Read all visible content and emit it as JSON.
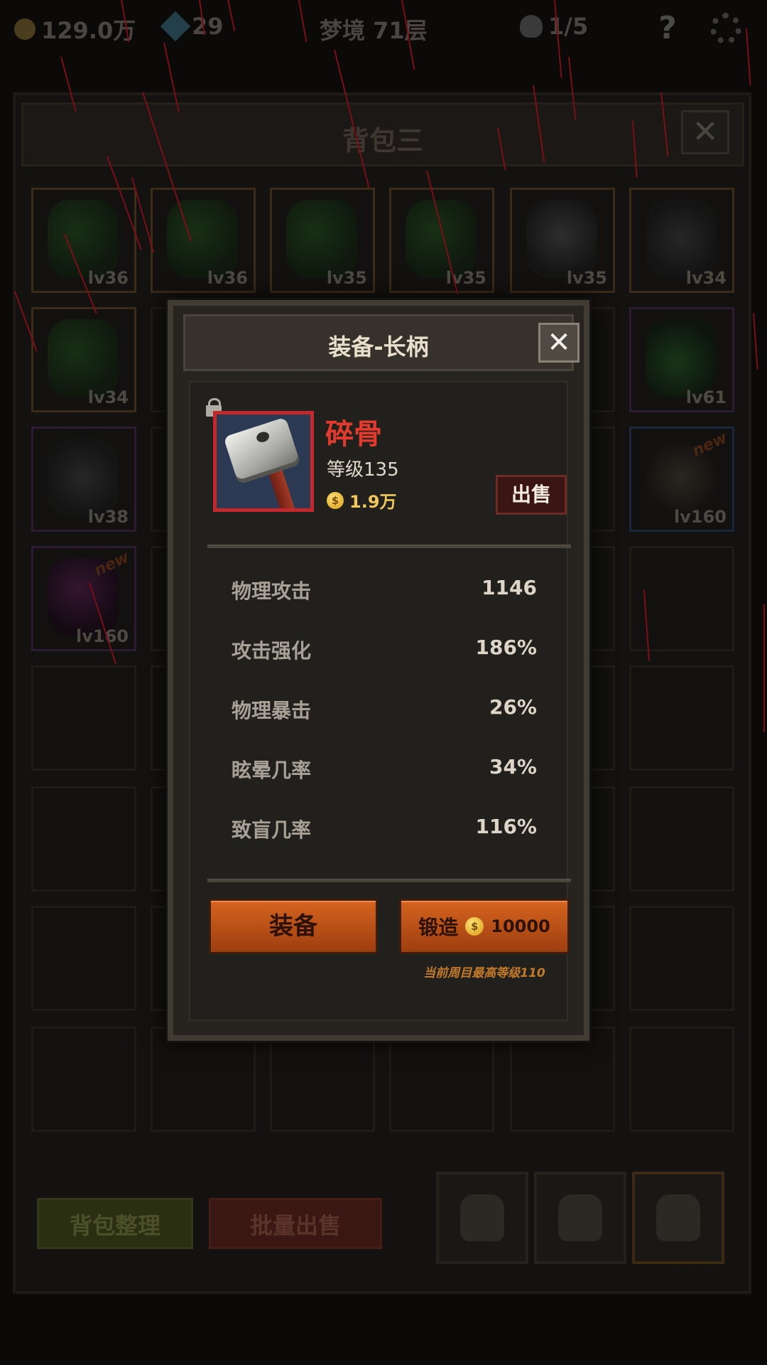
{
  "topbar": {
    "gold": "129.0万",
    "gems": "29",
    "dream": "梦境 71层",
    "skulls": "1/5"
  },
  "bag": {
    "title": "背包三",
    "close_label": "✕",
    "slots": [
      {
        "level": "lv36",
        "art": "green"
      },
      {
        "level": "lv36",
        "art": "green"
      },
      {
        "level": "lv35",
        "art": "green"
      },
      {
        "level": "lv35",
        "art": "green"
      },
      {
        "level": "lv35",
        "art": "helm"
      },
      {
        "level": "lv34",
        "art": "skull"
      },
      {
        "level": "lv34",
        "art": "green"
      },
      {
        "level": "lv61",
        "art": "orb"
      },
      {
        "level": "lv38",
        "art": "skull"
      },
      {
        "level": "lv160",
        "art": "ring",
        "new": "new"
      },
      {
        "level": "lv160",
        "art": "magic",
        "new": "new"
      }
    ],
    "sort_label": "背包整理",
    "bulk_sell_label": "批量出售"
  },
  "dialog": {
    "title": "装备-长柄",
    "close_label": "✕",
    "item": {
      "name": "碎骨",
      "level": "等级135",
      "price": "1.9万",
      "coin_symbol": "$"
    },
    "sell_label": "出售",
    "stats": [
      {
        "name": "物理攻击",
        "value": "1146"
      },
      {
        "name": "攻击强化",
        "value": "186%"
      },
      {
        "name": "物理暴击",
        "value": "26%"
      },
      {
        "name": "眩晕几率",
        "value": "34%"
      },
      {
        "name": "致盲几率",
        "value": "116%"
      }
    ],
    "equip_label": "装备",
    "forge_label": "锻造",
    "forge_cost": "10000",
    "forge_hint": "当前周目最高等级110"
  },
  "colors": {
    "item_name": "#e23a2e",
    "action_button": "#c75a1a",
    "rain": "#7a0f17"
  }
}
